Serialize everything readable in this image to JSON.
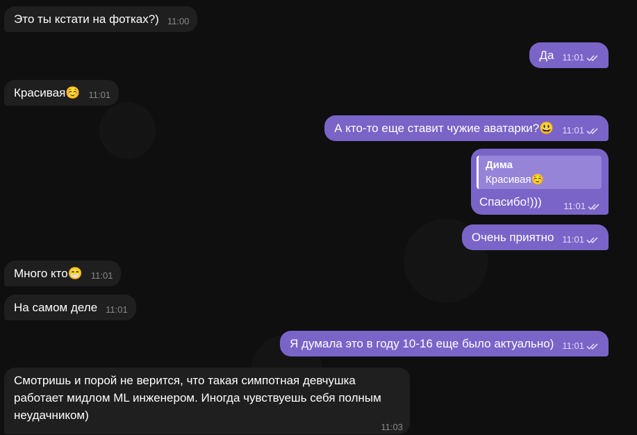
{
  "messages": [
    {
      "direction": "in",
      "text": "Это ты кстати на фотках?)",
      "emoji": "",
      "time": "11:00"
    },
    {
      "direction": "out",
      "text": "Да",
      "emoji": "",
      "time": "11:01"
    },
    {
      "direction": "in",
      "text": "Красивая",
      "emoji": "☺️",
      "time": "11:01"
    },
    {
      "direction": "out",
      "text": "А кто-то еще ставит чужие аватарки?",
      "emoji": "😃",
      "time": "11:01"
    },
    {
      "direction": "out",
      "reply": {
        "author": "Дима",
        "text": "Красивая",
        "emoji": "☺️"
      },
      "text": "Спасибо!)))",
      "emoji": "",
      "time": "11:01"
    },
    {
      "direction": "out",
      "text": "Очень приятно",
      "emoji": "",
      "time": "11:01"
    },
    {
      "direction": "in",
      "text": "Много кто",
      "emoji": "😁",
      "time": "11:01"
    },
    {
      "direction": "in",
      "text": "На самом деле",
      "emoji": "",
      "time": "11:01"
    },
    {
      "direction": "out",
      "text": "Я думала это в году 10-16 еще было актуально)",
      "emoji": "",
      "time": "11:01"
    },
    {
      "direction": "in",
      "text": "Смотришь и порой не верится, что такая симпотная девчушка работает мидлом ML инженером. Иногда чувствуешь себя полным неудачником)",
      "emoji": "",
      "time": "11:03"
    }
  ],
  "colors": {
    "incoming_bubble": "#1f1f1f",
    "outgoing_bubble": "#7a64c8",
    "background": "#0e0e0e"
  },
  "icons": {
    "read_status": "double-check-icon"
  }
}
